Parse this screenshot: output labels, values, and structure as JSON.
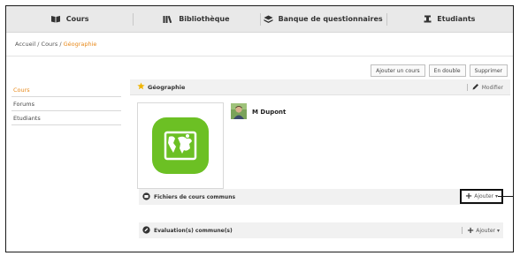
{
  "nav": {
    "tabs": [
      {
        "label": "Cours",
        "icon": "book-icon"
      },
      {
        "label": "Bibliothèque",
        "icon": "library-icon"
      },
      {
        "label": "Banque de questionnaires",
        "icon": "stack-icon"
      },
      {
        "label": "Etudiants",
        "icon": "person-icon"
      }
    ]
  },
  "breadcrumb": {
    "home": "Accueil",
    "sep1": " / ",
    "courses": "Cours",
    "sep2": " / ",
    "current": "Géographie"
  },
  "toolbar": {
    "add_course": "Ajouter un cours",
    "duplicate": "En double",
    "delete": "Supprimer"
  },
  "sidebar": {
    "items": [
      {
        "label": "Cours",
        "active": true
      },
      {
        "label": "Forums",
        "active": false
      },
      {
        "label": "Etudiants",
        "active": false
      }
    ]
  },
  "course": {
    "title": "Géographie",
    "edit_label": "Modifier",
    "teacher": "M Dupont"
  },
  "sections": {
    "common_files": {
      "title": "Fichiers de cours communs",
      "add_label": "Ajouter"
    },
    "common_evaluations": {
      "title": "Evaluation(s) commune(s)",
      "add_label": "Ajouter"
    }
  },
  "colors": {
    "accent": "#e8891a",
    "icon_green": "#6cc024",
    "frame": "#1a1a1a"
  }
}
